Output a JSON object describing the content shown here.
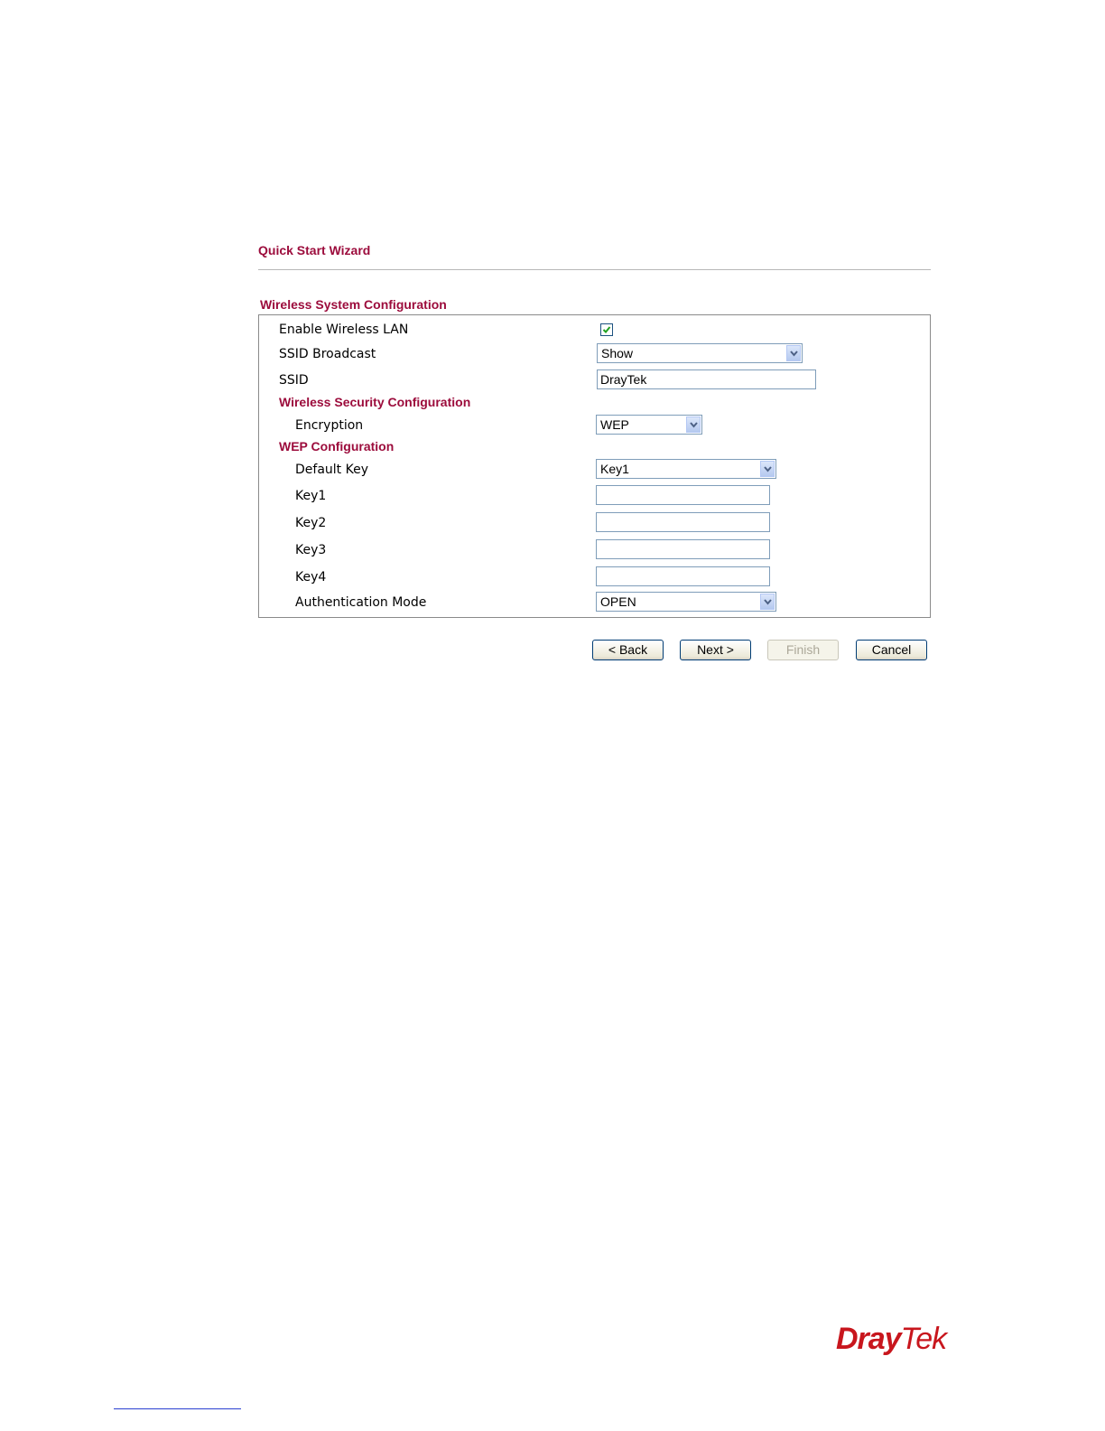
{
  "page": {
    "title": "Quick Start Wizard"
  },
  "section": {
    "title": "Wireless System Configuration"
  },
  "wireless": {
    "enable_label": "Enable Wireless LAN",
    "enable_checked": true,
    "ssid_broadcast_label": "SSID Broadcast",
    "ssid_broadcast_value": "Show",
    "ssid_label": "SSID",
    "ssid_value": "DrayTek"
  },
  "security": {
    "heading": "Wireless Security Configuration",
    "encryption_label": "Encryption",
    "encryption_value": "WEP"
  },
  "wep": {
    "heading": "WEP Configuration",
    "default_key_label": "Default Key",
    "default_key_value": "Key1",
    "keys": [
      {
        "label": "Key1",
        "value": ""
      },
      {
        "label": "Key2",
        "value": ""
      },
      {
        "label": "Key3",
        "value": ""
      },
      {
        "label": "Key4",
        "value": ""
      }
    ],
    "auth_mode_label": "Authentication Mode",
    "auth_mode_value": "OPEN"
  },
  "buttons": {
    "back": "< Back",
    "next": "Next >",
    "finish": "Finish",
    "cancel": "Cancel"
  },
  "colors": {
    "heading": "#9c0c3c",
    "logo": "#c8161d"
  },
  "icons": {
    "checkbox_check": "check-icon",
    "dropdown": "chevron-down-icon"
  },
  "logo": {
    "text_dray": "Dray",
    "text_tek": "Tek"
  }
}
